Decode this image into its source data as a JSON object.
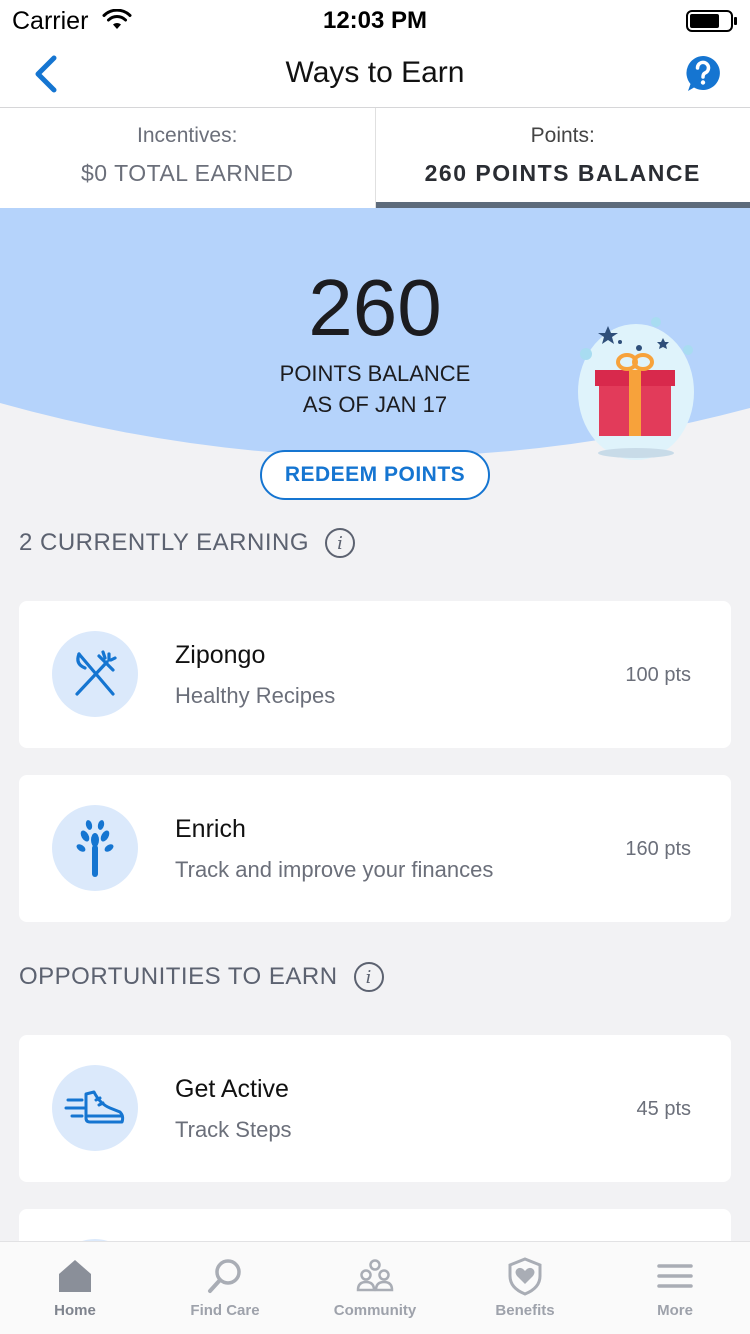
{
  "status_bar": {
    "carrier": "Carrier",
    "time": "12:03 PM"
  },
  "nav": {
    "title": "Ways to Earn",
    "back_icon": "chevron-left-icon",
    "help_icon": "help-bubble-icon",
    "accent": "#1575d1"
  },
  "tabs": [
    {
      "label": "Incentives:",
      "value": "$0 TOTAL EARNED",
      "selected": false
    },
    {
      "label": "Points:",
      "value": "260 POINTS BALANCE",
      "selected": true
    }
  ],
  "hero": {
    "points": "260",
    "caption_line1": "POINTS BALANCE",
    "caption_line2": "AS OF JAN 17",
    "background": "#b5d3fb",
    "redeem_label": "REDEEM POINTS"
  },
  "sections": {
    "earning_title": "2 CURRENTLY EARNING",
    "opportunities_title": "OPPORTUNITIES TO EARN"
  },
  "earning": [
    {
      "title": "Zipongo",
      "subtitle": "Healthy Recipes",
      "points": "100 pts",
      "icon": "fork-knife-icon"
    },
    {
      "title": "Enrich",
      "subtitle": "Track and improve your finances",
      "points": "160 pts",
      "icon": "sprout-icon"
    }
  ],
  "opportunities": [
    {
      "title": "Get Active",
      "subtitle": "Track Steps",
      "points": "45 pts",
      "icon": "running-shoe-icon"
    }
  ],
  "tab_bar": [
    {
      "label": "Home",
      "icon": "home-icon"
    },
    {
      "label": "Find Care",
      "icon": "search-icon"
    },
    {
      "label": "Community",
      "icon": "community-icon"
    },
    {
      "label": "Benefits",
      "icon": "shield-heart-icon"
    },
    {
      "label": "More",
      "icon": "menu-icon"
    }
  ]
}
